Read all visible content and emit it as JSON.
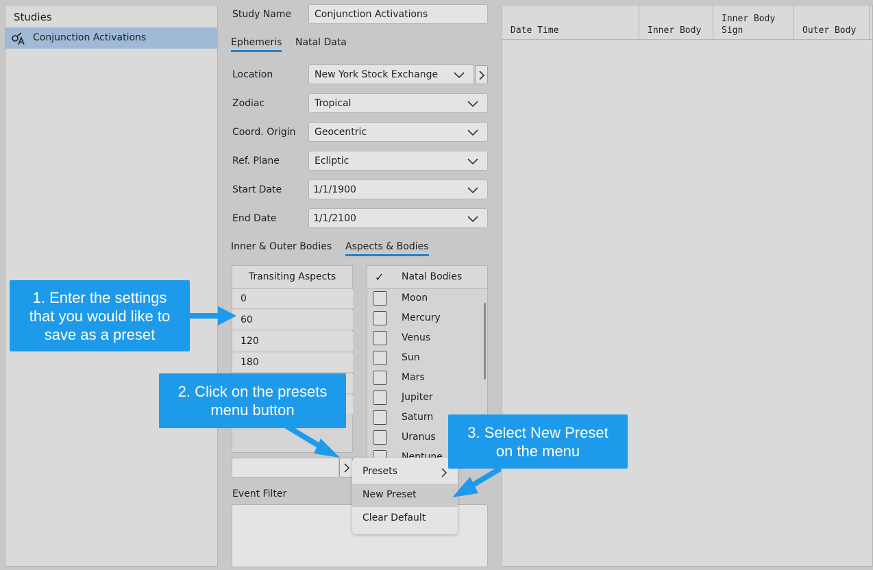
{
  "studies": {
    "title": "Studies",
    "items": [
      {
        "label": "Conjunction Activations",
        "icon": "aspect-icon"
      }
    ]
  },
  "form": {
    "study_name_label": "Study Name",
    "study_name_value": "Conjunction Activations",
    "tabs": [
      "Ephemeris",
      "Natal Data"
    ],
    "fields": [
      {
        "label": "Location",
        "value": "New York Stock Exchange"
      },
      {
        "label": "Zodiac",
        "value": "Tropical"
      },
      {
        "label": "Coord. Origin",
        "value": "Geocentric"
      },
      {
        "label": "Ref. Plane",
        "value": "Ecliptic"
      },
      {
        "label": "Start Date",
        "value": "1/1/1900"
      },
      {
        "label": "End Date",
        "value": "1/1/2100"
      }
    ],
    "subtabs": [
      "Inner & Outer Bodies",
      "Aspects & Bodies"
    ],
    "aspects_header": "Transiting Aspects",
    "aspects": [
      "0",
      "60",
      "120",
      "180"
    ],
    "bodies_header_check": "✓",
    "bodies_header": "Natal Bodies",
    "bodies": [
      "Moon",
      "Mercury",
      "Venus",
      "Sun",
      "Mars",
      "Jupiter",
      "Saturn",
      "Uranus",
      "Neptune"
    ],
    "event_filter_label": "Event Filter"
  },
  "table": {
    "columns": [
      "Date Time",
      "Inner Body",
      "Inner Body\nSign",
      "Outer Body"
    ]
  },
  "menu": {
    "items": [
      "Presets",
      "New Preset",
      "Clear Default"
    ],
    "highlighted": "New Preset"
  },
  "callouts": [
    "1. Enter the settings\nthat you would like to\nsave as a preset",
    "2. Click on the presets\nmenu button",
    "3. Select New Preset\non the menu"
  ],
  "colors": {
    "accent": "#1e82d2",
    "callout": "#1e9aea",
    "selection": "#9fbad6"
  }
}
